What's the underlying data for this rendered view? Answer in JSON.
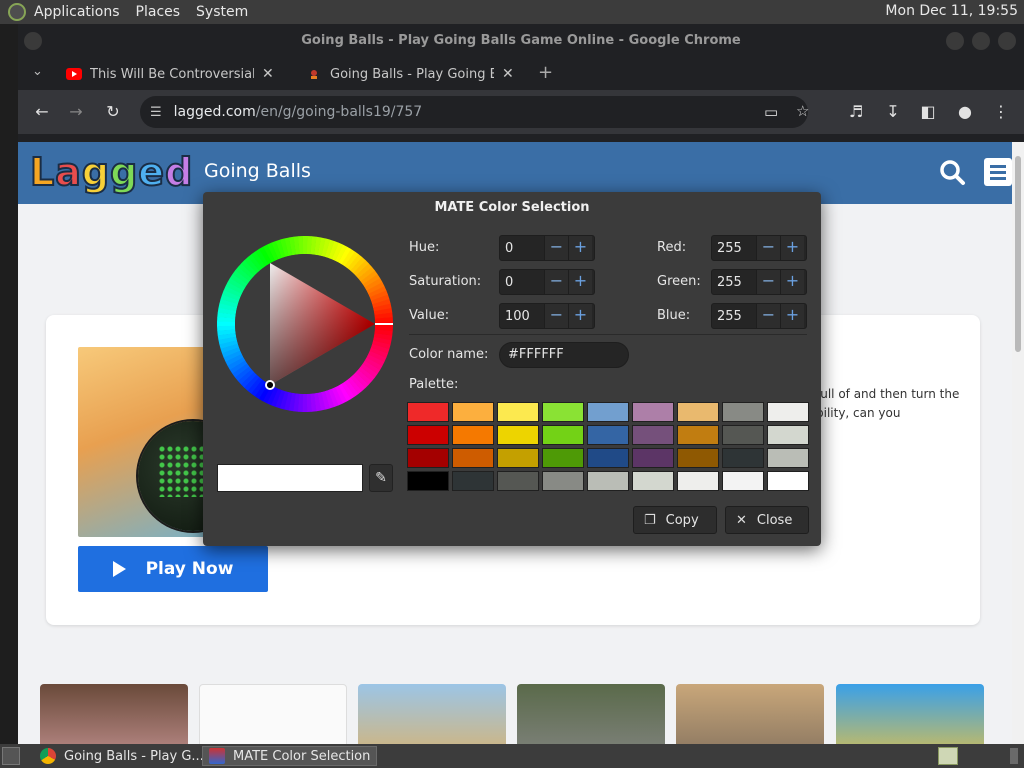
{
  "panel": {
    "menus": [
      "Applications",
      "Places",
      "System"
    ],
    "clock": "Mon Dec 11, 19:55"
  },
  "chrome": {
    "window_title": "Going Balls - Play Going Balls Game Online - Google Chrome",
    "tabs": [
      {
        "title": "This Will Be Controversial...",
        "favicon": "youtube-icon"
      },
      {
        "title": "Going Balls - Play Going Balls Game Online",
        "favicon": "lagged-icon"
      }
    ],
    "url_host": "lagged.com",
    "url_path": "/en/g/going-balls19/757"
  },
  "site": {
    "logo": "Lagged",
    "title": "Going Balls",
    "description": "full of and then turn the bility, can you",
    "play_label": "Play Now"
  },
  "dialog": {
    "title": "MATE Color Selection",
    "hue_label": "Hue:",
    "hue": "0",
    "saturation_label": "Saturation:",
    "saturation": "0",
    "value_label": "Value:",
    "value": "100",
    "red_label": "Red:",
    "red": "255",
    "green_label": "Green:",
    "green": "255",
    "blue_label": "Blue:",
    "blue": "255",
    "color_name_label": "Color name:",
    "color_name": "#FFFFFF",
    "palette_label": "Palette:",
    "palette": [
      "#ef2929",
      "#fcaf3e",
      "#fce94f",
      "#8ae234",
      "#729fcf",
      "#ad7fa8",
      "#e9b96e",
      "#888a85",
      "#eeeeec",
      "#cc0000",
      "#f57900",
      "#edd400",
      "#73d216",
      "#3465a4",
      "#75507b",
      "#c17d11",
      "#555753",
      "#d3d7cf",
      "#a40000",
      "#ce5c00",
      "#c4a000",
      "#4e9a06",
      "#204a87",
      "#5c3566",
      "#8f5902",
      "#2e3436",
      "#babdb6",
      "#000000",
      "#2e3436",
      "#555753",
      "#888a85",
      "#babdb6",
      "#d3d7cf",
      "#eeeeec",
      "#f3f3f3",
      "#ffffff"
    ],
    "copy_label": "Copy",
    "close_label": "Close"
  },
  "taskbar": {
    "items": [
      {
        "label": "Going Balls - Play G..."
      },
      {
        "label": "MATE Color Selection"
      }
    ]
  }
}
